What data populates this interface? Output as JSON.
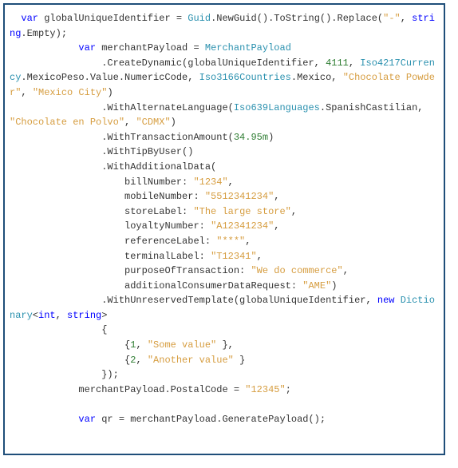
{
  "code": {
    "kw_var": "var",
    "kw_new": "new",
    "kw_string": "string",
    "kw_int": "int",
    "ident_globalUniqueIdentifier": "globalUniqueIdentifier",
    "ident_merchantPayload": "merchantPayload",
    "ident_qr": "qr",
    "type_MerchantPayload": "MerchantPayload",
    "type_Iso4217Currency": "Iso4217Currency",
    "type_Iso3166Countries": "Iso3166Countries",
    "type_Iso639Languages": "Iso639Languages",
    "type_Dictionary": "Dictionary",
    "call_Guid": "Guid",
    "call_NewGuid": ".NewGuid().ToString().Replace(",
    "lit_dash": "\"-\"",
    "call_empty": ".Empty);",
    "call_CreateDynamic_pre": "                .CreateDynamic(globalUniqueIdentifier, ",
    "num_4111": "4111",
    "mexicoPeso_tail": ".MexicoPeso.Value.NumericCode, ",
    "mexico_tail": ".Mexico, ",
    "str_chocolate_powder": "\"Chocolate Powder\"",
    "str_mexico_city": "\"Mexico City\"",
    "call_WithAlternateLanguage_pre": "                .WithAlternateLanguage(",
    "spanish_tail": ".SpanishCastilian, ",
    "str_chocolate_en_polvo": "\"Chocolate en Polvo\"",
    "str_cdmx": "\"CDMX\"",
    "call_WithTransactionAmount_pre": "                .WithTransactionAmount(",
    "num_3495m": "34.95m",
    "call_WithTipByUser": "                .WithTipByUser()",
    "call_WithAdditionalData": "                .WithAdditionalData(",
    "arg_billNumber_pre": "                    billNumber: ",
    "str_1234": "\"1234\"",
    "arg_mobileNumber_pre": "                    mobileNumber: ",
    "str_5512341234": "\"5512341234\"",
    "arg_storeLabel_pre": "                    storeLabel: ",
    "str_large_store": "\"The large store\"",
    "arg_loyaltyNumber_pre": "                    loyaltyNumber: ",
    "str_A12341234": "\"A12341234\"",
    "arg_referenceLabel_pre": "                    referenceLabel: ",
    "str_stars": "\"***\"",
    "arg_terminalLabel_pre": "                    terminalLabel: ",
    "str_T12341": "\"T12341\"",
    "arg_purposeOfTransaction_pre": "                    purposeOfTransaction: ",
    "str_we_do_commerce": "\"We do commerce\"",
    "arg_additionalConsumerDataRequest_pre": "                    additionalConsumerDataRequest: ",
    "str_AME": "\"AME\"",
    "call_WithUnreservedTemplate_pre": "                .WithUnreservedTemplate(globalUniqueIdentifier, ",
    "dict_open": "                {",
    "dict_entry1_pre": "                    {",
    "num_1": "1",
    "str_some_value": "\"Some value\"",
    "dict_entry_end": " },",
    "dict_entry2_pre": "                    {",
    "num_2": "2",
    "str_another_value": "\"Another value\"",
    "dict_entry_end2": " }",
    "dict_close": "                });",
    "postal_pre": "            merchantPayload.PostalCode = ",
    "str_12345": "\"12345\"",
    "qr_line_pre": "            ",
    "qr_line_mid": " qr = merchantPayload.GeneratePayload();"
  }
}
